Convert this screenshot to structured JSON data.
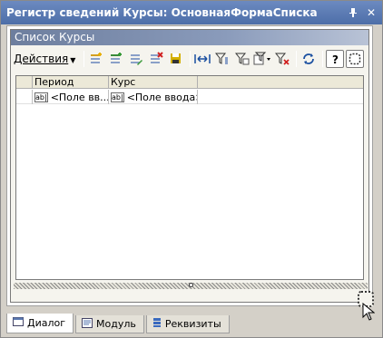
{
  "window": {
    "title": "Регистр сведений Курсы: ОсновнаяФормаСписка",
    "pin_glyph": "⊕",
    "close_glyph": "✕"
  },
  "form": {
    "header": "Список Курсы",
    "actions_menu_label": "Действия",
    "toolbar_icons": [
      "add-row-icon",
      "copy-row-icon",
      "edit-row-icon",
      "delete-row-icon",
      "save-icon",
      "set-interval-icon",
      "filter-icon",
      "filter-by-value-icon",
      "filter-menu-icon",
      "clear-filter-icon",
      "refresh-icon",
      "help-icon",
      "form-settings-icon"
    ]
  },
  "table": {
    "columns": [
      "",
      "Период",
      "Курс"
    ],
    "rows": [
      {
        "period": "<Поле вв...",
        "rate": "<Поле ввода>"
      }
    ],
    "field_icon_text": "ab|"
  },
  "tabs": [
    {
      "label": "Диалог",
      "icon": "dialog-icon",
      "active": true
    },
    {
      "label": "Модуль",
      "icon": "module-icon",
      "active": false
    },
    {
      "label": "Реквизиты",
      "icon": "attributes-icon",
      "active": false
    }
  ]
}
